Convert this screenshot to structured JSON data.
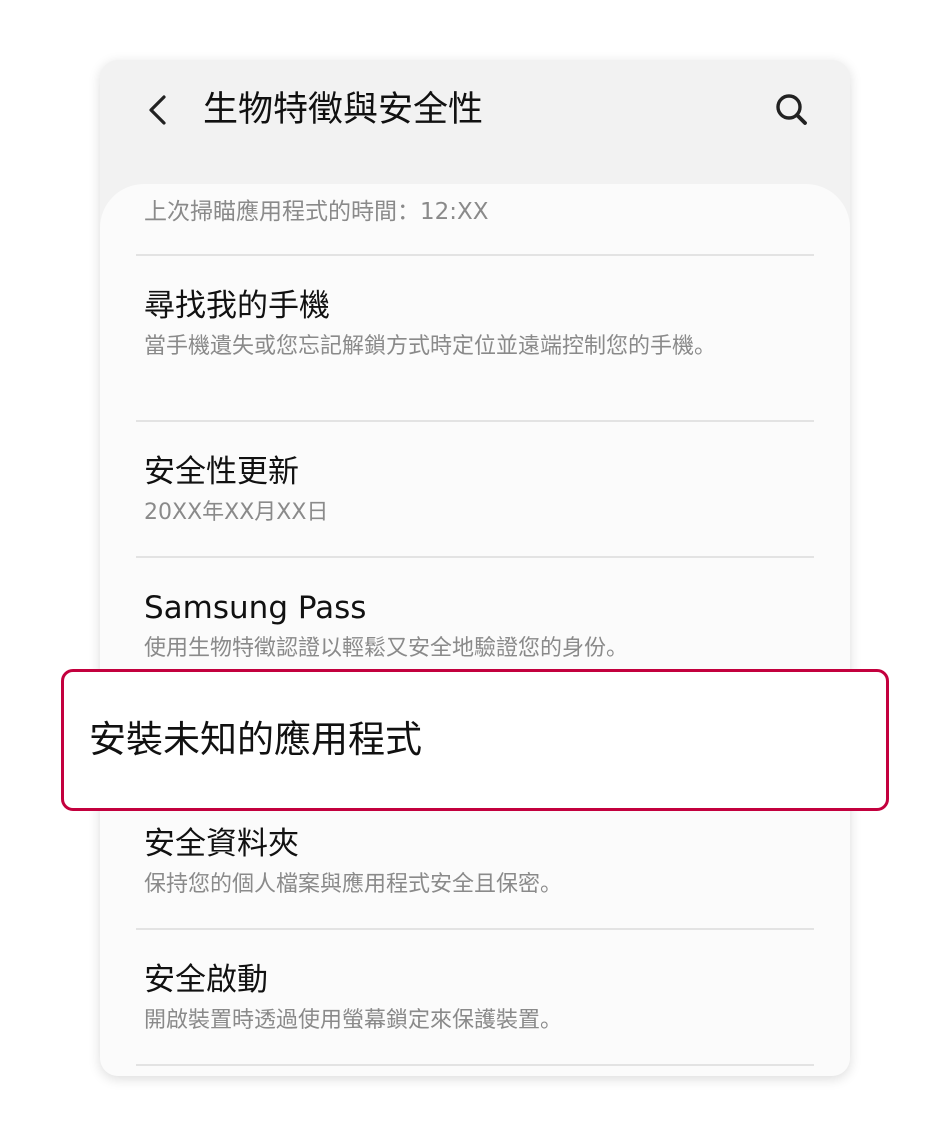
{
  "header": {
    "title": "生物特徵與安全性",
    "back_icon": "chevron-left-icon",
    "search_icon": "search-icon"
  },
  "scan_time": "上次掃瞄應用程式的時間：12:XX",
  "items": [
    {
      "title": "尋找我的手機",
      "subtitle": "當手機遺失或您忘記解鎖方式時定位並遠端控制您的手機。"
    },
    {
      "title": "安全性更新",
      "subtitle": "20XX年XX月XX日"
    },
    {
      "title": "Samsung Pass",
      "subtitle": "使用生物特徵認證以輕鬆又安全地驗證您的身份。"
    },
    {
      "title": "安全資料夾",
      "subtitle": "保持您的個人檔案與應用程式安全且保密。"
    },
    {
      "title": "安全啟動",
      "subtitle": "開啟裝置時透過使用螢幕鎖定來保護裝置。"
    }
  ],
  "highlight": {
    "label": "安裝未知的應用程式",
    "border_color": "#c3003e"
  }
}
